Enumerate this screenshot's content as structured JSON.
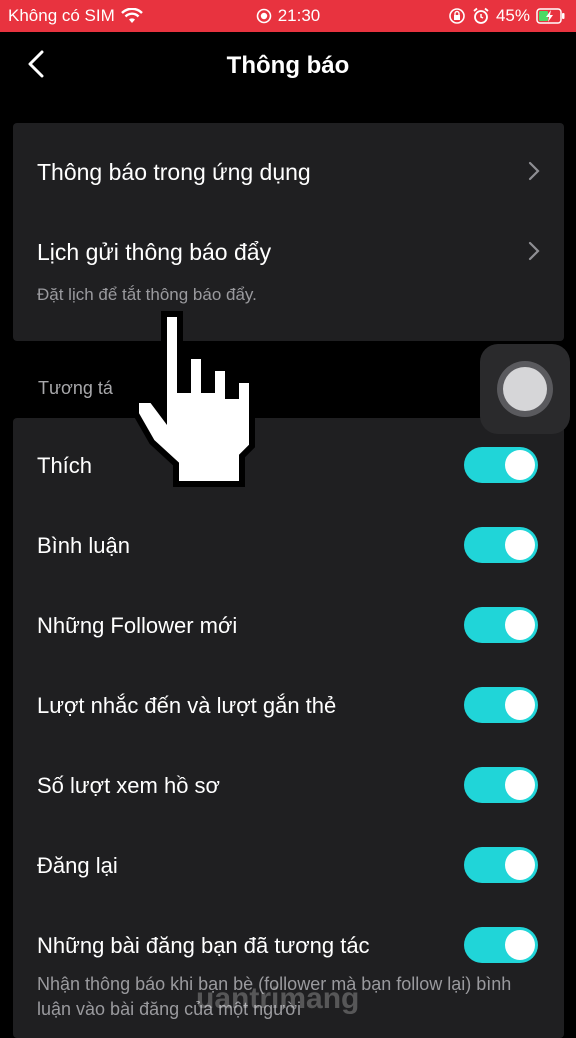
{
  "status_bar": {
    "carrier": "Không có SIM",
    "time": "21:30",
    "battery": "45%",
    "bar_color": "#e8333f"
  },
  "header": {
    "title": "Thông báo"
  },
  "top_card": {
    "items": [
      {
        "label": "Thông báo trong ứng dụng"
      },
      {
        "label": "Lịch gửi thông báo đẩy",
        "subtitle": "Đặt lịch để tắt thông báo đẩy."
      }
    ]
  },
  "section": {
    "label": "Tương tá"
  },
  "toggles": [
    {
      "label": "Thích",
      "on": true
    },
    {
      "label": "Bình luận",
      "on": true
    },
    {
      "label": "Những Follower mới",
      "on": true
    },
    {
      "label": "Lượt nhắc đến và lượt gắn thẻ",
      "on": true
    },
    {
      "label": "Số lượt xem hồ sơ",
      "on": true
    },
    {
      "label": "Đăng lại",
      "on": true
    },
    {
      "label": "Những bài đăng bạn đã tương tác",
      "on": true
    }
  ],
  "description": "Nhận thông báo khi bạn bè (follower mà bạn follow lại) bình luận vào bài đăng của một người",
  "accent_color": "#20d5d8",
  "watermark": "uantrimang"
}
